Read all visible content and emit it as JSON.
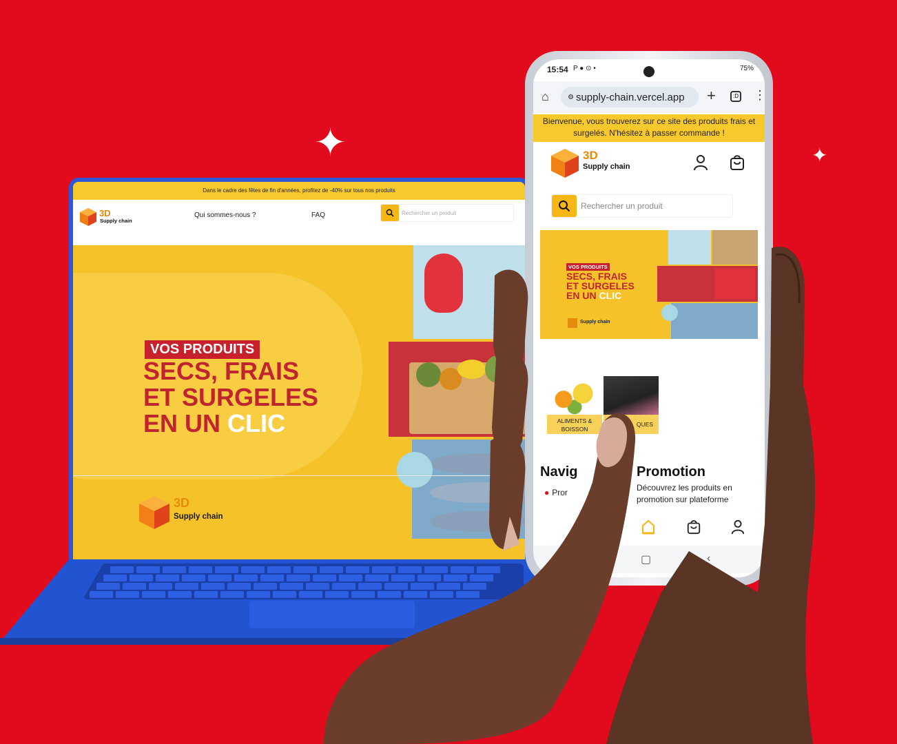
{
  "laptop_site": {
    "promo_banner": "Dans le cadre des fêtes de fin d'années, profitez de -40% sur tous nos produits",
    "logo": {
      "mark": "3D",
      "name": "Supply chain"
    },
    "nav": {
      "about": "Qui sommes-nous ?",
      "faq": "FAQ"
    },
    "search": {
      "placeholder": "Rechercher un produit",
      "icon": "search-icon"
    },
    "hero": {
      "tag": "VOS PRODUITS",
      "line1": "SECS, FRAIS",
      "line2": "ET SURGELES",
      "line3_prefix": "EN UN ",
      "line3_accent": "CLIC",
      "logo_mark": "3D",
      "logo_name": "Supply chain"
    }
  },
  "phone": {
    "status": {
      "time": "15:54",
      "icons_left": "P ● ⊙ •",
      "right": "75%"
    },
    "browser": {
      "url": "supply-chain.vercel.app",
      "tabs_count": ":D"
    },
    "welcome_banner": "Bienvenue, vous trouverez sur ce site des produits frais et surgelés. N'hésitez à passer commande !",
    "logo": {
      "mark": "3D",
      "name": "Supply chain"
    },
    "search": {
      "placeholder": "Rechercher un produit"
    },
    "hero": {
      "tag": "VOS PRODUITS",
      "line1": "SECS, FRAIS",
      "line2": "ET SURGELES",
      "line3_prefix": "EN UN ",
      "line3_accent": "CLIC",
      "logo_name": "Supply chain"
    },
    "categories": [
      {
        "label": "ALIMENTS & BOISSON"
      },
      {
        "label": "QUES"
      }
    ],
    "section_left": {
      "title": "Navig",
      "item": "Pror"
    },
    "section_right": {
      "title": "Promotion",
      "desc": "Découvrez les produits en promotion sur plateforme"
    }
  },
  "colors": {
    "background": "#e20a1d",
    "brand_yellow": "#f5c22a",
    "brand_red": "#c0252f",
    "laptop_blue": "#2253d0",
    "search_button": "#f5b616"
  }
}
